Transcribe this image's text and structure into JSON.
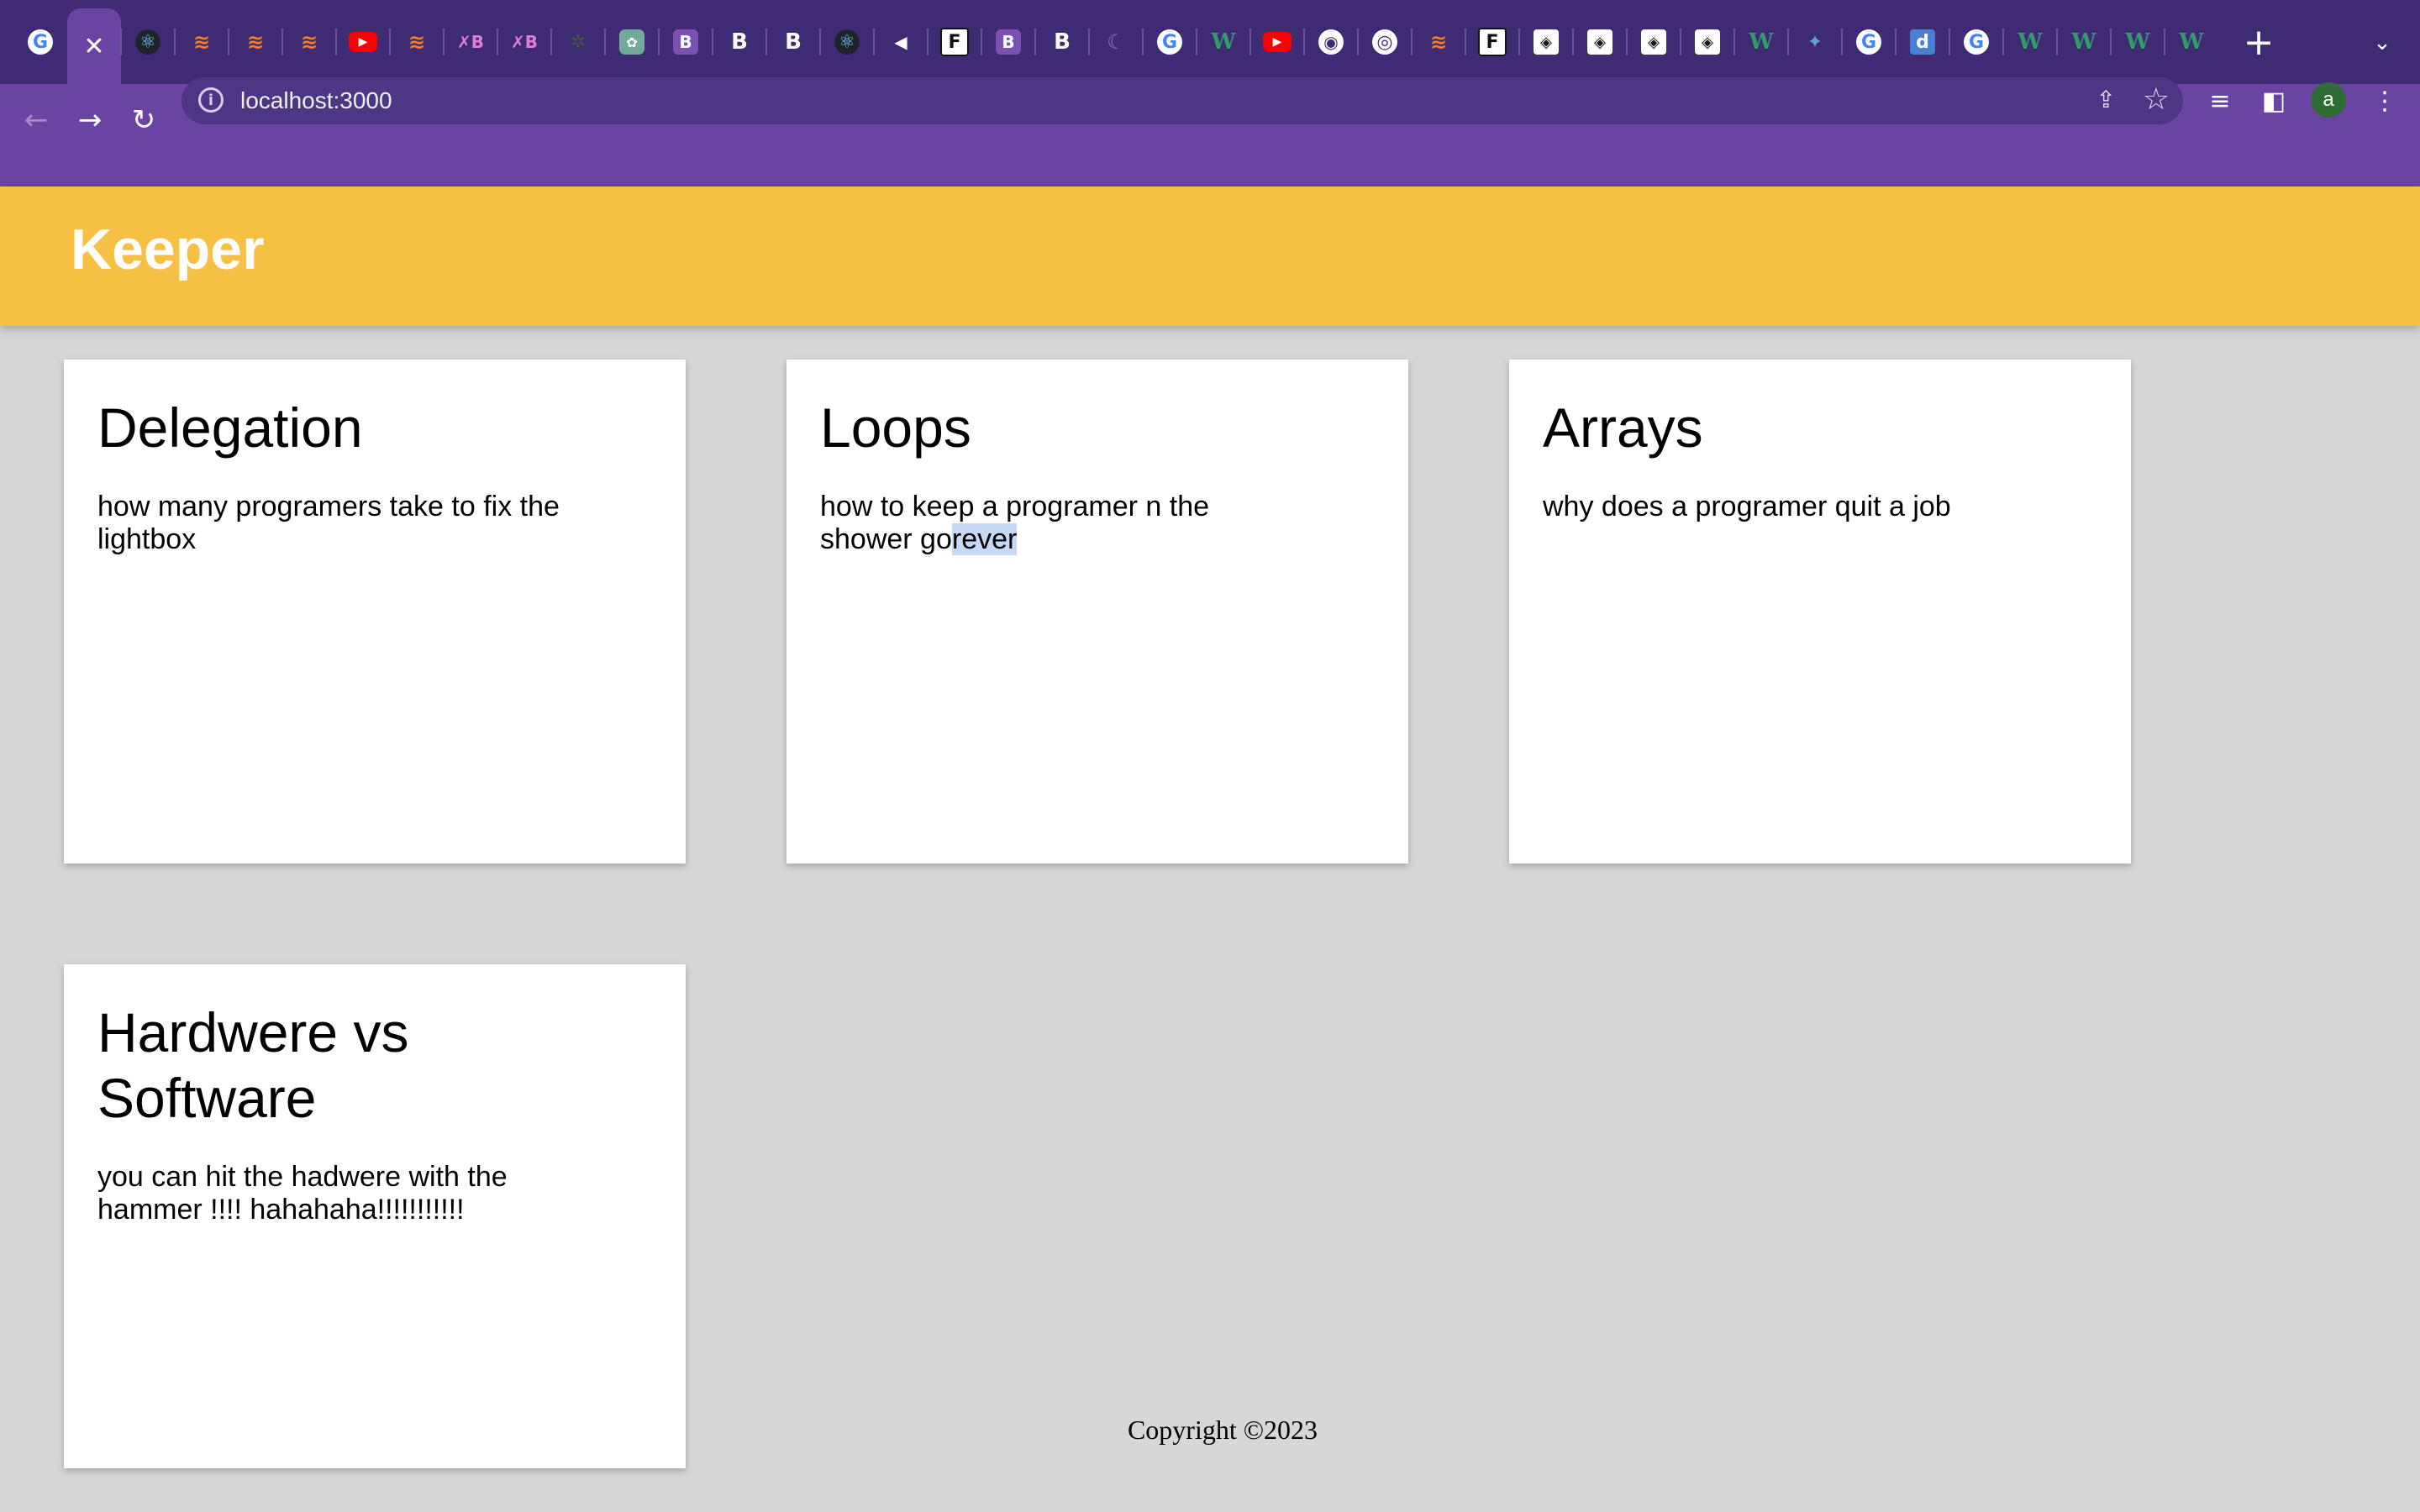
{
  "browser": {
    "tabs": [
      {
        "icon": "google-icon",
        "glyph": "G",
        "style": "google"
      },
      {
        "icon": "close-icon",
        "glyph": "✕",
        "style": "active"
      },
      {
        "icon": "react-icon",
        "glyph": "⚛",
        "style": "react"
      },
      {
        "icon": "stackoverflow-icon",
        "glyph": "≋",
        "style": "so"
      },
      {
        "icon": "stackoverflow-icon",
        "glyph": "≋",
        "style": "so"
      },
      {
        "icon": "stackoverflow-icon",
        "glyph": "≋",
        "style": "so"
      },
      {
        "icon": "youtube-icon",
        "glyph": "▶",
        "style": "yt"
      },
      {
        "icon": "stackoverflow-icon",
        "glyph": "≋",
        "style": "so"
      },
      {
        "icon": "xb-icon",
        "glyph": "✗B",
        "style": "xb"
      },
      {
        "icon": "xb-icon",
        "glyph": "✗B",
        "style": "xb"
      },
      {
        "icon": "leaf-icon",
        "glyph": "✲",
        "style": "leaf"
      },
      {
        "icon": "chatgpt-icon",
        "glyph": "✿",
        "style": "chatgpt"
      },
      {
        "icon": "bootstrap-icon",
        "glyph": "B",
        "style": "bs-purple"
      },
      {
        "icon": "bootstrap-icon",
        "glyph": "B",
        "style": "bs-dark"
      },
      {
        "icon": "bootstrap-icon",
        "glyph": "B",
        "style": "bs-dark"
      },
      {
        "icon": "react-icon",
        "glyph": "⚛",
        "style": "react"
      },
      {
        "icon": "muted-icon",
        "glyph": "◀",
        "style": "mute"
      },
      {
        "icon": "figma-icon",
        "glyph": "F",
        "style": "figma"
      },
      {
        "icon": "bootstrap-icon",
        "glyph": "B",
        "style": "bs-purple"
      },
      {
        "icon": "bootstrap-icon",
        "glyph": "B",
        "style": "bs-dark"
      },
      {
        "icon": "moon-icon",
        "glyph": "☾",
        "style": "moon"
      },
      {
        "icon": "google-icon",
        "glyph": "G",
        "style": "google"
      },
      {
        "icon": "w3schools-icon",
        "glyph": "W",
        "style": "w"
      },
      {
        "icon": "youtube-icon",
        "glyph": "▶",
        "style": "yt"
      },
      {
        "icon": "globe-icon",
        "glyph": "◉",
        "style": "world"
      },
      {
        "icon": "chrome-icon",
        "glyph": "◎",
        "style": "chrome"
      },
      {
        "icon": "stackoverflow-icon",
        "glyph": "≋",
        "style": "so"
      },
      {
        "icon": "figma-icon",
        "glyph": "F",
        "style": "figma"
      },
      {
        "icon": "codepen-icon",
        "glyph": "◈",
        "style": "cp"
      },
      {
        "icon": "codepen-icon",
        "glyph": "◈",
        "style": "cp"
      },
      {
        "icon": "codepen-icon",
        "glyph": "◈",
        "style": "cp"
      },
      {
        "icon": "codepen-icon",
        "glyph": "◈",
        "style": "cp"
      },
      {
        "icon": "w3schools-icon",
        "glyph": "W",
        "style": "w"
      },
      {
        "icon": "spark-icon",
        "glyph": "✦",
        "style": "spark"
      },
      {
        "icon": "google-icon",
        "glyph": "G",
        "style": "google"
      },
      {
        "icon": "d-icon",
        "glyph": "d",
        "style": "d"
      },
      {
        "icon": "google-icon",
        "glyph": "G",
        "style": "google"
      },
      {
        "icon": "w3schools-icon",
        "glyph": "W",
        "style": "w"
      },
      {
        "icon": "w3schools-icon",
        "glyph": "W",
        "style": "w"
      },
      {
        "icon": "w3schools-icon",
        "glyph": "W",
        "style": "w"
      },
      {
        "icon": "w3schools-icon",
        "glyph": "W",
        "style": "w"
      }
    ],
    "new_tab_glyph": "+",
    "tab_list_glyph": "⌄",
    "address": "localhost:3000",
    "profile_initial": "a"
  },
  "app": {
    "title": "Keeper"
  },
  "notes": [
    {
      "title": "Delegation",
      "content": "how many programers take to fix the lightbox"
    },
    {
      "title": "Loops",
      "content_before": "how to keep a programer n the shower go",
      "content_selected": "rever"
    },
    {
      "title": "Arrays",
      "content": "why does a programer quit a job"
    },
    {
      "title": "Hardwere vs Software",
      "content": "you can hit the hadwere with the hammer !!!! hahahaha!!!!!!!!!!!"
    }
  ],
  "footer": {
    "text": "Copyright ©2023"
  },
  "colors": {
    "tabstrip": "#3f2b73",
    "toolbar": "#6a44a3",
    "header": "#f5c044",
    "background": "#d7d7d7"
  }
}
